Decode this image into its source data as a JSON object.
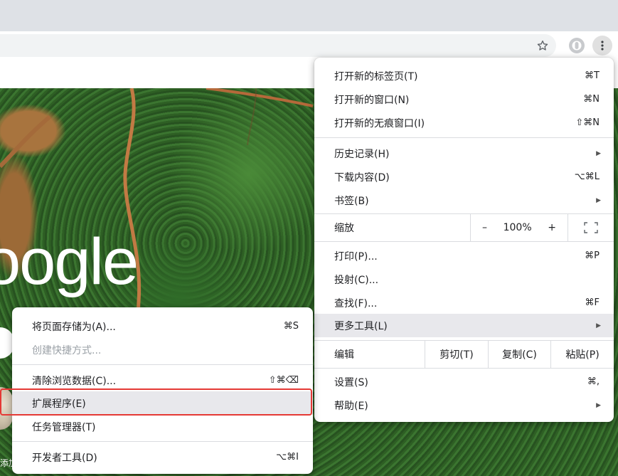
{
  "main_menu": {
    "new_tab": {
      "label": "打开新的标签页(T)",
      "shortcut": "⌘T"
    },
    "new_window": {
      "label": "打开新的窗口(N)",
      "shortcut": "⌘N"
    },
    "new_incognito": {
      "label": "打开新的无痕窗口(I)",
      "shortcut": "⇧⌘N"
    },
    "history": {
      "label": "历史记录(H)"
    },
    "downloads": {
      "label": "下载内容(D)",
      "shortcut": "⌥⌘L"
    },
    "bookmarks": {
      "label": "书签(B)"
    },
    "zoom": {
      "label": "缩放",
      "minus": "–",
      "level": "100%",
      "plus": "+"
    },
    "print": {
      "label": "打印(P)...",
      "shortcut": "⌘P"
    },
    "cast": {
      "label": "投射(C)..."
    },
    "find": {
      "label": "查找(F)...",
      "shortcut": "⌘F"
    },
    "more_tools": {
      "label": "更多工具(L)"
    },
    "edit": {
      "label": "编辑",
      "cut": "剪切(T)",
      "copy": "复制(C)",
      "paste": "粘贴(P)"
    },
    "settings": {
      "label": "设置(S)",
      "shortcut": "⌘,"
    },
    "help": {
      "label": "帮助(E)"
    }
  },
  "sub_menu": {
    "save_page": {
      "label": "将页面存储为(A)...",
      "shortcut": "⌘S"
    },
    "create_shortcut": {
      "label": "创建快捷方式..."
    },
    "clear_data": {
      "label": "清除浏览数据(C)...",
      "shortcut": "⇧⌘⌫"
    },
    "extensions": {
      "label": "扩展程序(E)"
    },
    "task_manager": {
      "label": "任务管理器(T)"
    },
    "dev_tools": {
      "label": "开发者工具(D)",
      "shortcut": "⌥⌘I"
    }
  },
  "page": {
    "logo_text": "oogle",
    "shortcut_label": "添加"
  },
  "colors": {
    "highlight_border": "#e53935",
    "menu_hover": "#e8e8ec"
  }
}
